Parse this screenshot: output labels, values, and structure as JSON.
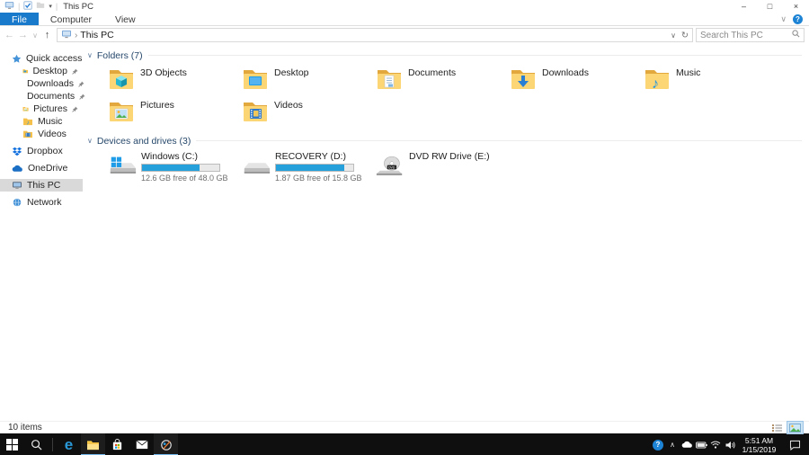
{
  "window": {
    "title": "This PC"
  },
  "ribbon": {
    "tabs": [
      {
        "label": "File"
      },
      {
        "label": "Computer"
      },
      {
        "label": "View"
      }
    ]
  },
  "navbar": {
    "breadcrumb": "This PC",
    "search_placeholder": "Search This PC"
  },
  "sidebar": {
    "items": [
      {
        "label": "Quick access",
        "icon": "star",
        "pinned": false
      },
      {
        "label": "Desktop",
        "icon": "folder-desktop",
        "pinned": true
      },
      {
        "label": "Downloads",
        "icon": "folder-downloads",
        "pinned": true
      },
      {
        "label": "Documents",
        "icon": "folder-documents",
        "pinned": true
      },
      {
        "label": "Pictures",
        "icon": "folder-pictures",
        "pinned": true
      },
      {
        "label": "Music",
        "icon": "folder-music",
        "pinned": false
      },
      {
        "label": "Videos",
        "icon": "folder-videos",
        "pinned": false
      },
      {
        "label": "Dropbox",
        "icon": "dropbox",
        "pinned": false
      },
      {
        "label": "OneDrive",
        "icon": "onedrive-cloud",
        "pinned": false
      },
      {
        "label": "This PC",
        "icon": "computer",
        "pinned": false,
        "selected": true
      },
      {
        "label": "Network",
        "icon": "network",
        "pinned": false
      }
    ]
  },
  "main": {
    "groups": [
      {
        "label": "Folders (7)"
      },
      {
        "label": "Devices and drives (3)"
      }
    ],
    "folders": [
      {
        "label": "3D Objects"
      },
      {
        "label": "Desktop"
      },
      {
        "label": "Documents"
      },
      {
        "label": "Downloads"
      },
      {
        "label": "Music"
      },
      {
        "label": "Pictures"
      },
      {
        "label": "Videos"
      }
    ],
    "drives": [
      {
        "label": "Windows (C:)",
        "free": "12.6 GB free of 48.0 GB",
        "used_pct": 74
      },
      {
        "label": "RECOVERY (D:)",
        "free": "1.87 GB free of 15.8 GB",
        "used_pct": 88
      },
      {
        "label": "DVD RW Drive (E:)",
        "free": "",
        "used_pct": 0
      }
    ]
  },
  "statusbar": {
    "count": "10 items"
  },
  "taskbar": {
    "time": "5:51 AM",
    "date": "1/15/2019"
  },
  "icons": {
    "minimize": "–",
    "maximize": "□",
    "close": "×",
    "back": "←",
    "forward": "→",
    "up": "↑",
    "chevron_down": "∨",
    "refresh": "↻",
    "breadcrumb_sep": "›",
    "qat_dropdown": "▾",
    "ribbon_collapse": "∨",
    "tray_chevron": "∧",
    "help": "?",
    "edge": "e"
  },
  "colors": {
    "accent": "#1979ca",
    "bar_fill": "#26a0da",
    "selection": "#d9d9d9",
    "taskbar_bg": "#0f0f0f",
    "group_header": "#26486b"
  }
}
